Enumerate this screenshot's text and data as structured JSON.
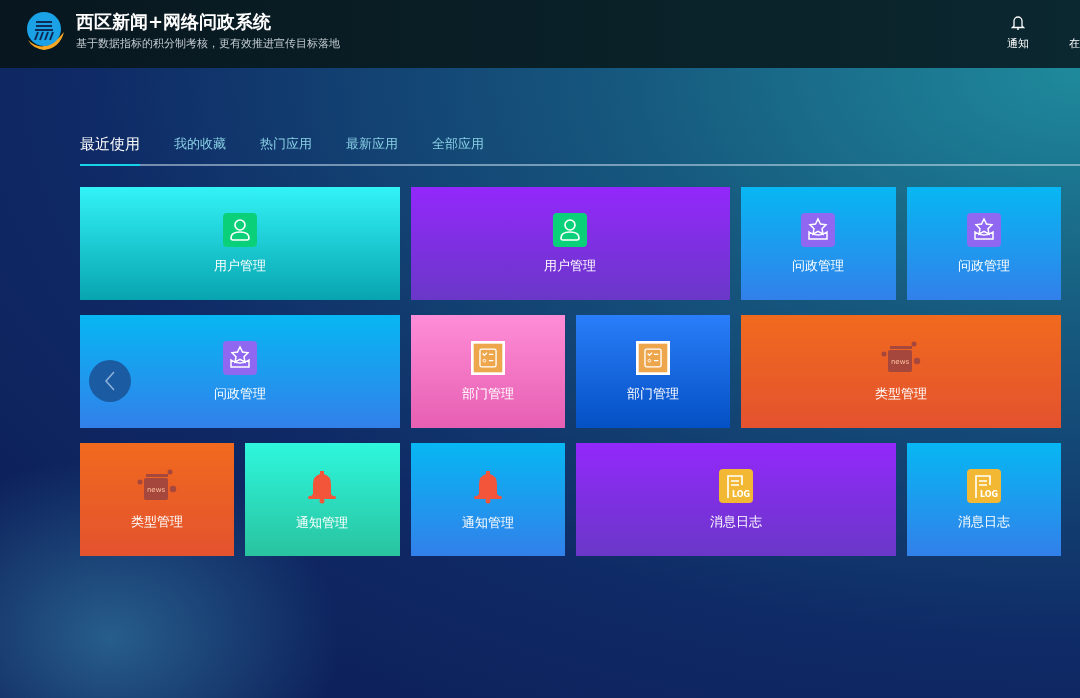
{
  "header": {
    "title": "西区新闻+网络问政系统",
    "subtitle": "基于数据指标的积分制考核，更有效推进宣传目标落地",
    "actions": [
      {
        "label": "通知",
        "kind": "bell"
      },
      {
        "label": "在",
        "kind": "text"
      }
    ]
  },
  "tabs": [
    {
      "label": "最近使用",
      "selected": true
    },
    {
      "label": "我的收藏",
      "selected": false
    },
    {
      "label": "热门应用",
      "selected": false
    },
    {
      "label": "最新应用",
      "selected": false
    },
    {
      "label": "全部应用",
      "selected": false
    }
  ],
  "tiles": [
    {
      "label": "用户管理",
      "kind": "user",
      "color": "#33f3f7",
      "wide": true
    },
    {
      "label": "用户管理",
      "kind": "user",
      "color": "#9328fb",
      "wide": true
    },
    {
      "label": "问政管理",
      "kind": "star",
      "color": "#07b7f3",
      "wide": false
    },
    {
      "label": "问政管理",
      "kind": "star",
      "color": "#07b7f3",
      "wide": false
    },
    {
      "label": "问政管理",
      "kind": "star",
      "color": "#07b7f3",
      "wide": true
    },
    {
      "label": "部门管理",
      "kind": "checklist",
      "color": "#fe8dd7",
      "wide": false
    },
    {
      "label": "部门管理",
      "kind": "checklist",
      "color": "#2a7ef9",
      "wide": false
    },
    {
      "label": "类型管理",
      "kind": "news",
      "icon_text": "news",
      "color": "#f06a1e",
      "wide": true
    },
    {
      "label": "类型管理",
      "kind": "news",
      "icon_text": "news",
      "color": "#f06a1e",
      "wide": false
    },
    {
      "label": "通知管理",
      "kind": "bell",
      "color": "#2ef7dd",
      "wide": false
    },
    {
      "label": "通知管理",
      "kind": "bell",
      "color": "#07b7f3",
      "wide": false
    },
    {
      "label": "消息日志",
      "kind": "log",
      "icon_text": "LOG",
      "color": "#9328fb",
      "wide": true
    },
    {
      "label": "消息日志",
      "kind": "log",
      "icon_text": "LOG",
      "color": "#07b7f3",
      "wide": false
    }
  ],
  "carousel": {
    "prev": true
  }
}
